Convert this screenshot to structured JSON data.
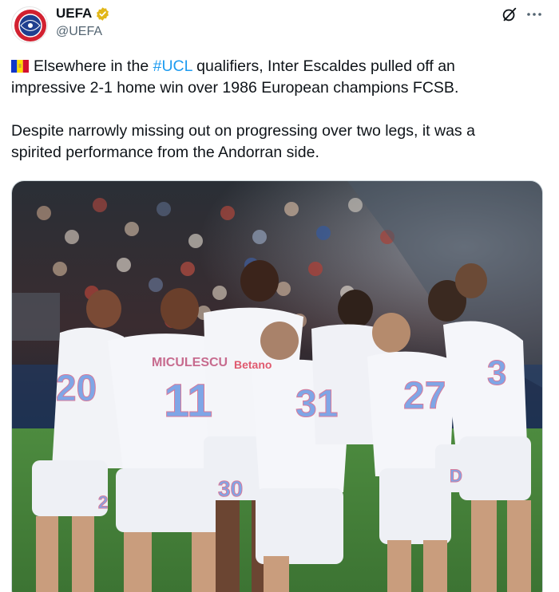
{
  "author": {
    "display_name": "UEFA",
    "handle": "@UEFA",
    "avatar_icon": "uefa-logo-icon",
    "verified_icon": "verified-gold-badge-icon",
    "verified_color": "#e2b719"
  },
  "actions": {
    "grok_icon": "grok-icon",
    "more_icon": "more-options-icon"
  },
  "tweet": {
    "line1_pre": "Elsewhere in the ",
    "hashtag": "#UCL",
    "line1_post": " qualifiers, Inter Escaldes pulled off an",
    "line2": "impressive 2-1 home win over 1986 European champions FCSB.",
    "line3": "Despite narrowly missing out on progressing over two legs, it was a",
    "line4": "spirited performance from the Andorran side.",
    "flag_icon": "andorra-flag-icon"
  },
  "media": {
    "shirt_texts": {
      "name1": "MICULESCU",
      "sponsor": "Betano",
      "num_20": "20",
      "num_11": "11",
      "num_31": "31",
      "num_27": "27",
      "num_3": "3",
      "num_30": "30",
      "num_2": "2",
      "num_d": "D"
    }
  },
  "colors": {
    "link": "#1d9bf0",
    "secondary_text": "#536471",
    "shirt_number": "#7fa6e6"
  }
}
